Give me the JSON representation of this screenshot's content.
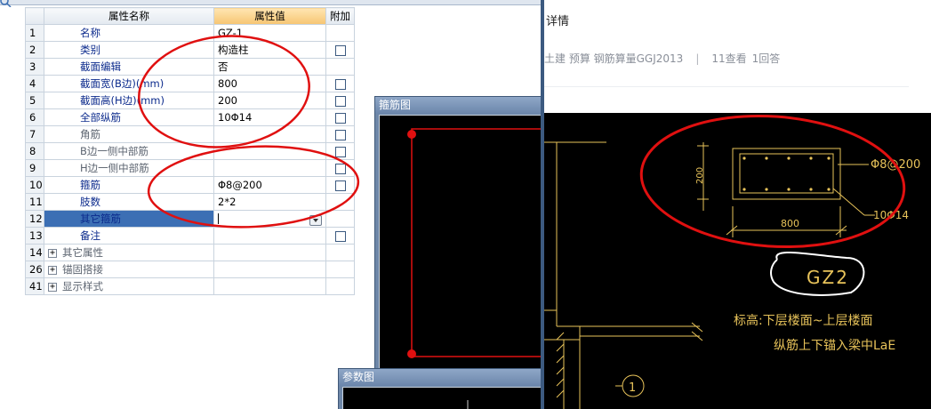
{
  "property_panel": {
    "headers": {
      "index": "",
      "name": "属性名称",
      "value": "属性值",
      "attach": "附加"
    },
    "rows": [
      {
        "index": "1",
        "name": "名称",
        "value": "GZ-1",
        "checkbox": false,
        "style": "normal"
      },
      {
        "index": "2",
        "name": "类别",
        "value": "构造柱",
        "checkbox": true,
        "style": "normal"
      },
      {
        "index": "3",
        "name": "截面编辑",
        "value": "否",
        "checkbox": false,
        "style": "normal"
      },
      {
        "index": "4",
        "name": "截面宽(B边)(mm)",
        "value": "800",
        "checkbox": true,
        "style": "normal"
      },
      {
        "index": "5",
        "name": "截面高(H边)(mm)",
        "value": "200",
        "checkbox": true,
        "style": "normal"
      },
      {
        "index": "6",
        "name": "全部纵筋",
        "value": "10Φ14",
        "checkbox": true,
        "style": "normal"
      },
      {
        "index": "7",
        "name": "角筋",
        "value": "",
        "checkbox": true,
        "style": "gray"
      },
      {
        "index": "8",
        "name": "B边一侧中部筋",
        "value": "",
        "checkbox": true,
        "style": "gray"
      },
      {
        "index": "9",
        "name": "H边一侧中部筋",
        "value": "",
        "checkbox": true,
        "style": "gray"
      },
      {
        "index": "10",
        "name": "箍筋",
        "value": "Φ8@200",
        "checkbox": true,
        "style": "normal"
      },
      {
        "index": "11",
        "name": "肢数",
        "value": "2*2",
        "checkbox": false,
        "style": "normal"
      },
      {
        "index": "12",
        "name": "其它箍筋",
        "value": "",
        "checkbox": false,
        "style": "selected"
      },
      {
        "index": "13",
        "name": "备注",
        "value": "",
        "checkbox": true,
        "style": "normal"
      },
      {
        "index": "14",
        "name": "其它属性",
        "value": "",
        "checkbox": false,
        "style": "expand"
      },
      {
        "index": "26",
        "name": "锚固搭接",
        "value": "",
        "checkbox": false,
        "style": "expand"
      },
      {
        "index": "41",
        "name": "显示样式",
        "value": "",
        "checkbox": false,
        "style": "expand"
      }
    ]
  },
  "stirrup_window": {
    "title": "箍筋图"
  },
  "param_window": {
    "title": "参数图"
  },
  "web_page": {
    "title_fragment": "详情",
    "meta": {
      "tags": "土建 预算 钢筋算量GGJ2013",
      "views": "11查看",
      "answers": "1回答"
    }
  },
  "cad_drawing": {
    "stirrup_label": "Φ8@200",
    "rebar_label": "10Φ14",
    "width_dim": "800",
    "height_dim": "200",
    "column_id": "GZ2",
    "note_line1": "标高:下层楼面~上层楼面",
    "note_line2": "纵筋上下锚入梁中LaE",
    "grid_bubble": "1"
  },
  "colors": {
    "annotation_red": "#e01010",
    "cad_yellow": "#e8c35a",
    "selected_row": "#3c6fb4",
    "header_value": "#f6c572"
  }
}
